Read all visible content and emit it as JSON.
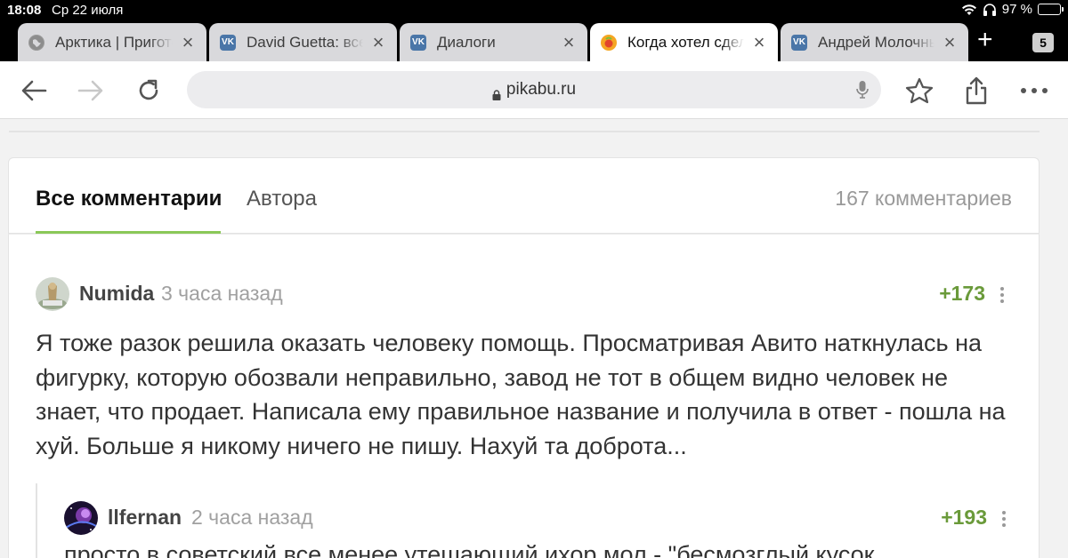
{
  "status": {
    "time": "18:08",
    "date": "Ср 22 июля",
    "battery": "97 %"
  },
  "tabs": [
    {
      "title": "Арктика | Приготовление",
      "icon": "globe-icon"
    },
    {
      "title": "David Guetta: все песни",
      "icon": "vk-icon"
    },
    {
      "title": "Диалоги",
      "icon": "vk-icon"
    },
    {
      "title": "Когда хотел сделать",
      "icon": "pikabu-icon",
      "active": true
    },
    {
      "title": "Андрей Молочный",
      "icon": "vk-icon"
    }
  ],
  "tab_count": "5",
  "url": "pikabu.ru",
  "comments_header": {
    "all_label": "Все комментарии",
    "author_label": "Автора",
    "count_label": "167 комментариев"
  },
  "comment": {
    "author": "Numida",
    "time": "3 часа назад",
    "rating": "+173",
    "text": "Я тоже разок решила оказать человеку помощь. Просматривая Авито наткнулась на фигурку, которую обозвали неправильно, завод не тот в общем видно человек не знает, что продает. Написала ему правильное название и получила  в ответ - пошла на хуй. Больше я никому ничего не пишу. Нахуй та доброта..."
  },
  "reply": {
    "author": "llfernan",
    "time": "2 часа назад",
    "rating": "+193",
    "text": "просто в советский все менее утешающий ихор мол - \"бесмозглый кусок"
  },
  "colors": {
    "accent_green": "#8ac858",
    "rating_green": "#6a9a3a"
  }
}
